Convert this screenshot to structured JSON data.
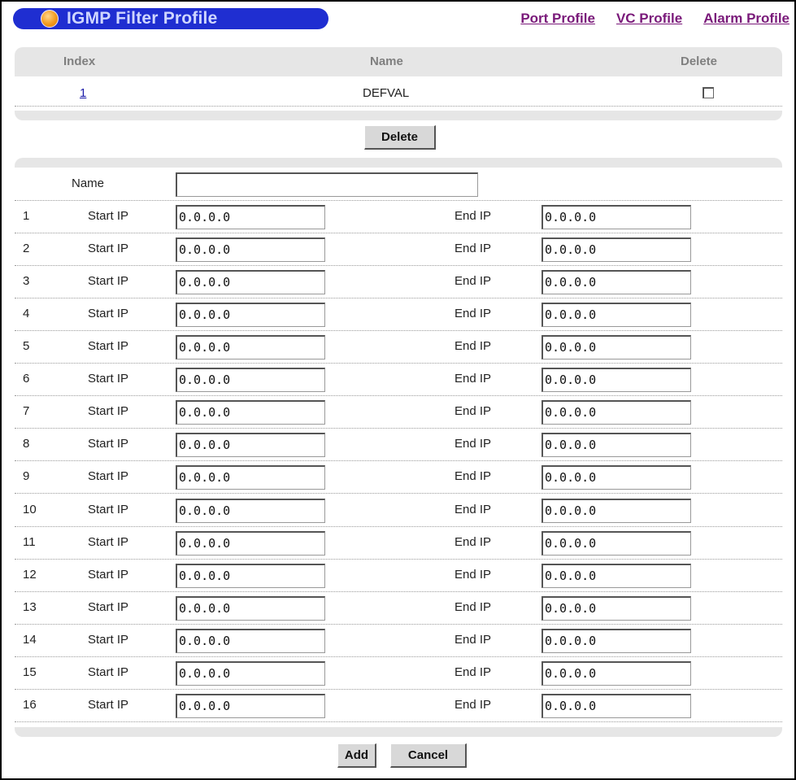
{
  "header": {
    "title": "IGMP Filter Profile",
    "links": [
      "Port Profile",
      "VC Profile",
      "Alarm Profile"
    ]
  },
  "list": {
    "columns": {
      "index": "Index",
      "name": "Name",
      "delete": "Delete"
    },
    "rows": [
      {
        "index": "1",
        "name": "DEFVAL"
      }
    ],
    "delete_button": "Delete"
  },
  "form": {
    "name_label": "Name",
    "name_value": "",
    "start_label": "Start IP",
    "end_label": "End IP",
    "entries": [
      {
        "n": "1",
        "start": "0.0.0.0",
        "end": "0.0.0.0"
      },
      {
        "n": "2",
        "start": "0.0.0.0",
        "end": "0.0.0.0"
      },
      {
        "n": "3",
        "start": "0.0.0.0",
        "end": "0.0.0.0"
      },
      {
        "n": "4",
        "start": "0.0.0.0",
        "end": "0.0.0.0"
      },
      {
        "n": "5",
        "start": "0.0.0.0",
        "end": "0.0.0.0"
      },
      {
        "n": "6",
        "start": "0.0.0.0",
        "end": "0.0.0.0"
      },
      {
        "n": "7",
        "start": "0.0.0.0",
        "end": "0.0.0.0"
      },
      {
        "n": "8",
        "start": "0.0.0.0",
        "end": "0.0.0.0"
      },
      {
        "n": "9",
        "start": "0.0.0.0",
        "end": "0.0.0.0"
      },
      {
        "n": "10",
        "start": "0.0.0.0",
        "end": "0.0.0.0"
      },
      {
        "n": "11",
        "start": "0.0.0.0",
        "end": "0.0.0.0"
      },
      {
        "n": "12",
        "start": "0.0.0.0",
        "end": "0.0.0.0"
      },
      {
        "n": "13",
        "start": "0.0.0.0",
        "end": "0.0.0.0"
      },
      {
        "n": "14",
        "start": "0.0.0.0",
        "end": "0.0.0.0"
      },
      {
        "n": "15",
        "start": "0.0.0.0",
        "end": "0.0.0.0"
      },
      {
        "n": "16",
        "start": "0.0.0.0",
        "end": "0.0.0.0"
      }
    ],
    "add_button": "Add",
    "cancel_button": "Cancel"
  },
  "colors": {
    "title_pill": "#1f2ed1",
    "link": "#7a1a7a",
    "panel_gray": "#e6e6e6"
  },
  "icons": {
    "title_dot": "orange-orb-icon",
    "delete_checkbox": "checkbox-icon"
  }
}
